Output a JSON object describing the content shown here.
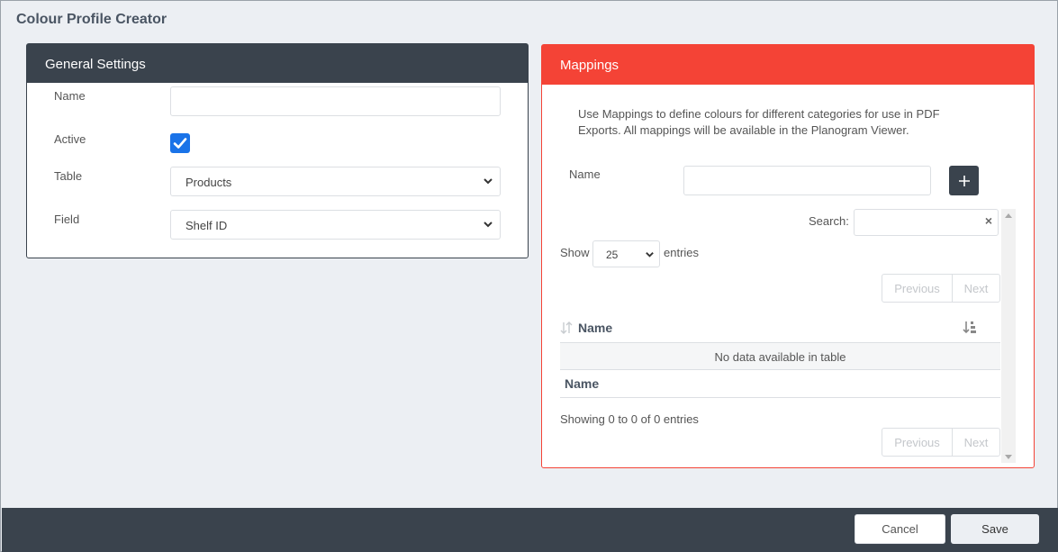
{
  "page": {
    "title": "Colour Profile Creator"
  },
  "general": {
    "header": "General Settings",
    "name_label": "Name",
    "name_value": "",
    "active_label": "Active",
    "active_checked": true,
    "table_label": "Table",
    "table_value": "Products",
    "field_label": "Field",
    "field_value": "Shelf ID"
  },
  "mappings": {
    "header": "Mappings",
    "help_text": "Use Mappings to define colours for different categories for use in PDF Exports. All mappings will be available in the Planogram Viewer.",
    "name_label": "Name",
    "name_value": "",
    "search_label": "Search:",
    "search_value": "",
    "show_label": "Show",
    "page_size": "25",
    "entries_label": "entries",
    "prev_label": "Previous",
    "next_label": "Next",
    "column_header": "Name",
    "empty_text": "No data available in table",
    "footer_column": "Name",
    "info_text": "Showing 0 to 0 of 0 entries"
  },
  "footer": {
    "cancel_label": "Cancel",
    "save_label": "Save"
  },
  "colors": {
    "dark": "#3a434d",
    "accent": "#f44336",
    "checkbox": "#1a73e8",
    "background": "#eceff3"
  },
  "icons": {
    "add": "plus-icon",
    "clear": "clear-x-icon",
    "select": "chevron-down-icon",
    "sort": "sort-icon",
    "sort_active": "sort-ascending-icon"
  }
}
